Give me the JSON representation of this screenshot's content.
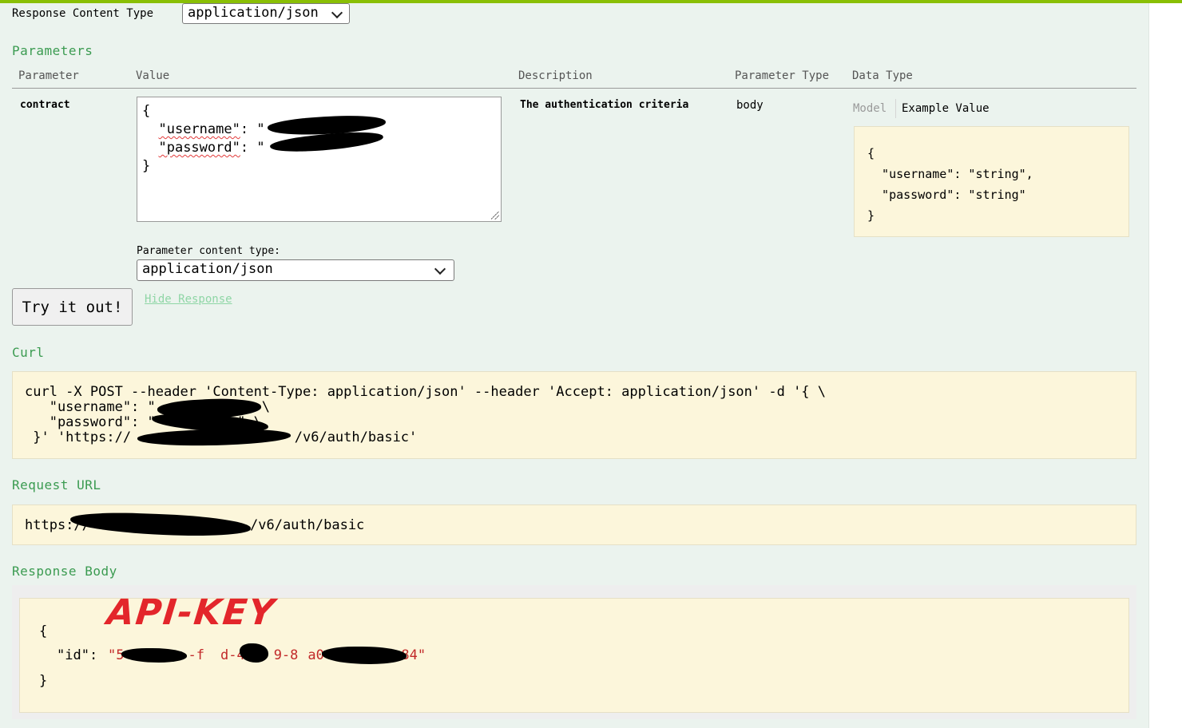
{
  "colors": {
    "accent_bar": "#89bf04",
    "panel_bg": "#ebf3ee",
    "section_title": "#3b9b51",
    "code_bg": "#fcf6db",
    "string_value": "#c22a2a",
    "annotation": "#e3262b"
  },
  "response_content_type": {
    "label": "Response Content Type",
    "selected": "application/json"
  },
  "parameters": {
    "title": "Parameters",
    "headers": [
      "Parameter",
      "Value",
      "Description",
      "Parameter Type",
      "Data Type"
    ],
    "row": {
      "name": "contract",
      "value_lines": {
        "open": "{",
        "username_key": "\"username\"",
        "password_key": "\"password\"",
        "colon": ": \"",
        "close": "}"
      },
      "description": "The authentication criteria",
      "parameter_type": "body",
      "data_type_tabs": [
        "Model",
        "Example Value"
      ],
      "example_value": "{\n  \"username\": \"string\",\n  \"password\": \"string\"\n}"
    },
    "content_type_label": "Parameter content type:",
    "content_type_selected": "application/json"
  },
  "actions": {
    "try_button": "Try it out!",
    "hide_response": "Hide Response"
  },
  "curl": {
    "title": "Curl",
    "line1": "curl -X POST --header 'Content-Type: application/json' --header 'Accept: application/json' -d '{ \\",
    "line2": "   \"username\": \"          \", \\",
    "line3": "   \"password\": \"          \" \\",
    "line4": " }' 'https://                    /v6/auth/basic'"
  },
  "request_url": {
    "title": "Request URL",
    "value_prefix": "https://",
    "value_suffix": "/v6/auth/basic"
  },
  "response_body": {
    "title": "Response Body",
    "open": "{",
    "id_key": "\"id\": ",
    "id_value_start": "\"5",
    "id_value_mid1": "-f",
    "id_value_mid2": "d-4",
    "id_value_mid3": "9-8",
    "id_value_mid4": "a0-7",
    "id_value_end": "84\"",
    "close": "}",
    "annotation": "API-KEY"
  }
}
